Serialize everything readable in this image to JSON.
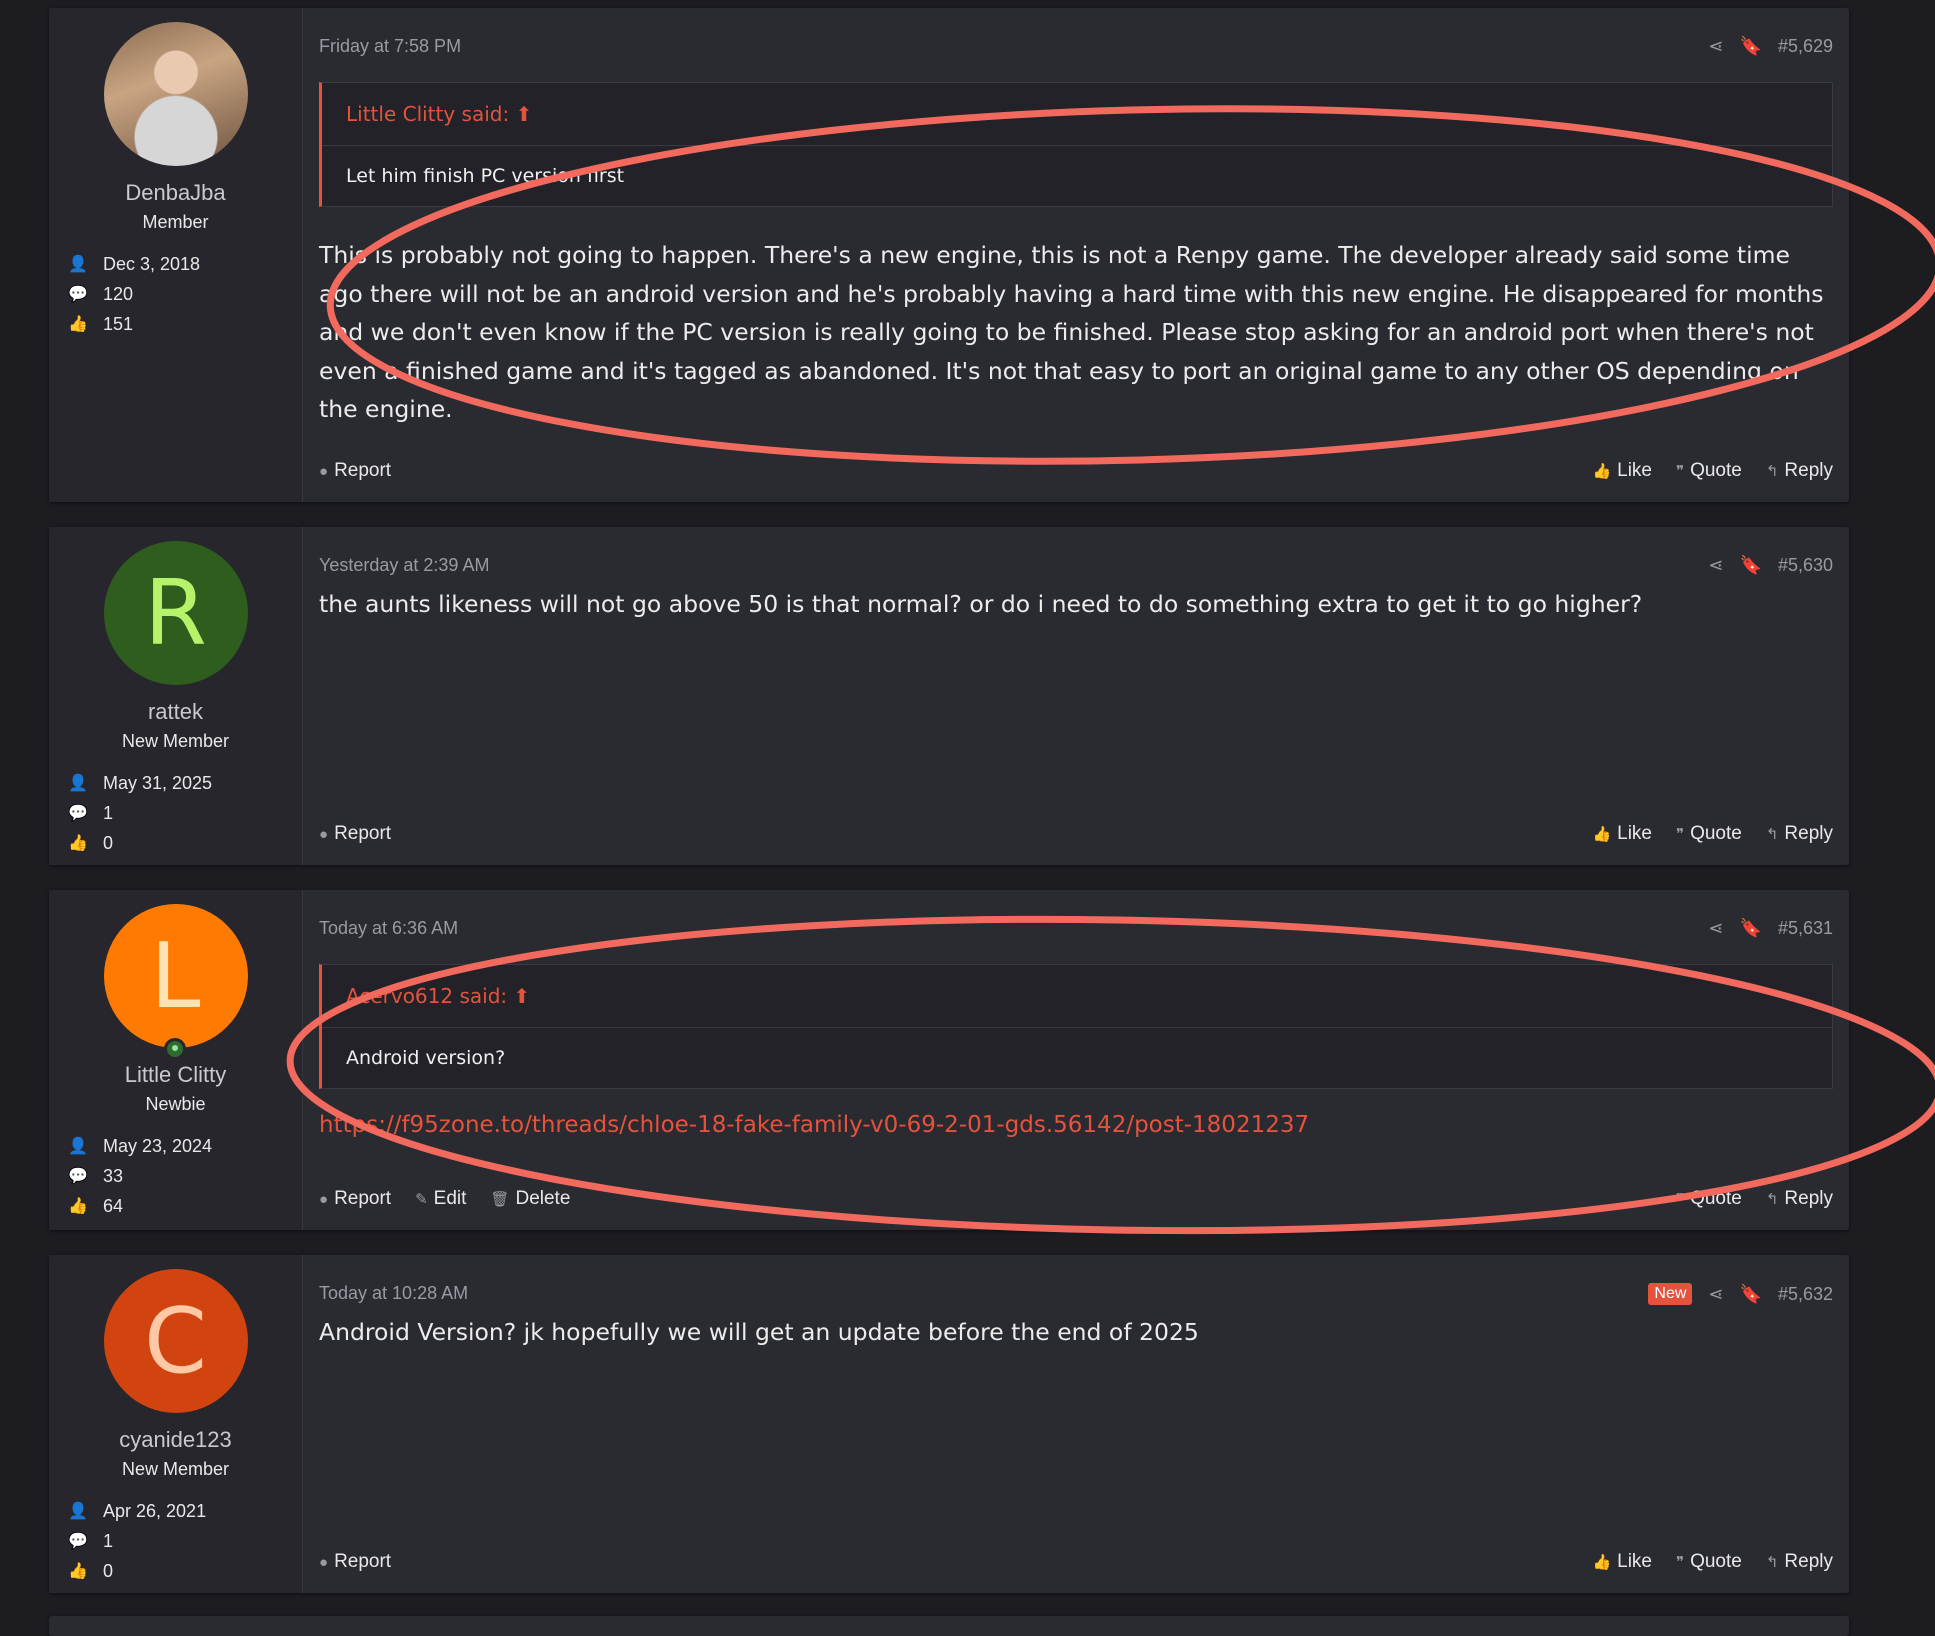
{
  "posts": [
    {
      "username": "DenbaJba",
      "usertitle": "Member",
      "joined": "Dec 3, 2018",
      "messages": "120",
      "reactions": "151",
      "date": "Friday at 7:58 PM",
      "number": "#5,629",
      "quote_author": "Little Clitty said:",
      "quote_text": "Let him finish PC version first",
      "message": "This is probably not going to happen. There's a new engine, this is not a Renpy game. The developer already said some time ago there will not be an android version and he's probably having a hard time with this new engine. He disappeared for months and we don't even know if the PC version is really going to be finished. Please stop asking for an android port when there's not even a finished game and it's tagged as abandoned. It's not that easy to port an original game to any other OS depending on the engine."
    },
    {
      "username": "rattek",
      "usertitle": "New Member",
      "avatar_letter": "R",
      "joined": "May 31, 2025",
      "messages": "1",
      "reactions": "0",
      "date": "Yesterday at 2:39 AM",
      "number": "#5,630",
      "message": "the aunts likeness will not go above 50 is that normal? or do i need to do something extra to get it to go higher?"
    },
    {
      "username": "Little Clitty",
      "usertitle": "Newbie",
      "avatar_letter": "L",
      "joined": "May 23, 2024",
      "messages": "33",
      "reactions": "64",
      "date": "Today at 6:36 AM",
      "number": "#5,631",
      "quote_author": "Acervo612 said:",
      "quote_text": "Android version?",
      "link": "https://f95zone.to/threads/chloe-18-fake-family-v0-69-2-01-gds.56142/post-18021237"
    },
    {
      "username": "cyanide123",
      "usertitle": "New Member",
      "avatar_letter": "C",
      "joined": "Apr 26, 2021",
      "messages": "1",
      "reactions": "0",
      "date": "Today at 10:28 AM",
      "number": "#5,632",
      "badge": "New",
      "message": "Android Version? jk hopefully we will get an update before the end of 2025"
    }
  ],
  "actions": {
    "report": "Report",
    "edit": "Edit",
    "delete": "Delete",
    "like": "Like",
    "quote": "Quote",
    "reply": "Reply"
  },
  "colors": {
    "accent": "#e5533d",
    "annotation": "#f26a5e",
    "avatar_r": "#2e5d1e",
    "avatar_l": "#ff7a00",
    "avatar_c": "#d2440f"
  },
  "icons": [
    "user-icon",
    "comments-icon",
    "thumbs-up-icon",
    "share-icon",
    "bookmark-icon",
    "arrow-up-circle-icon",
    "report-icon",
    "edit-icon",
    "delete-icon",
    "like-icon",
    "quote-icon",
    "reply-icon"
  ]
}
